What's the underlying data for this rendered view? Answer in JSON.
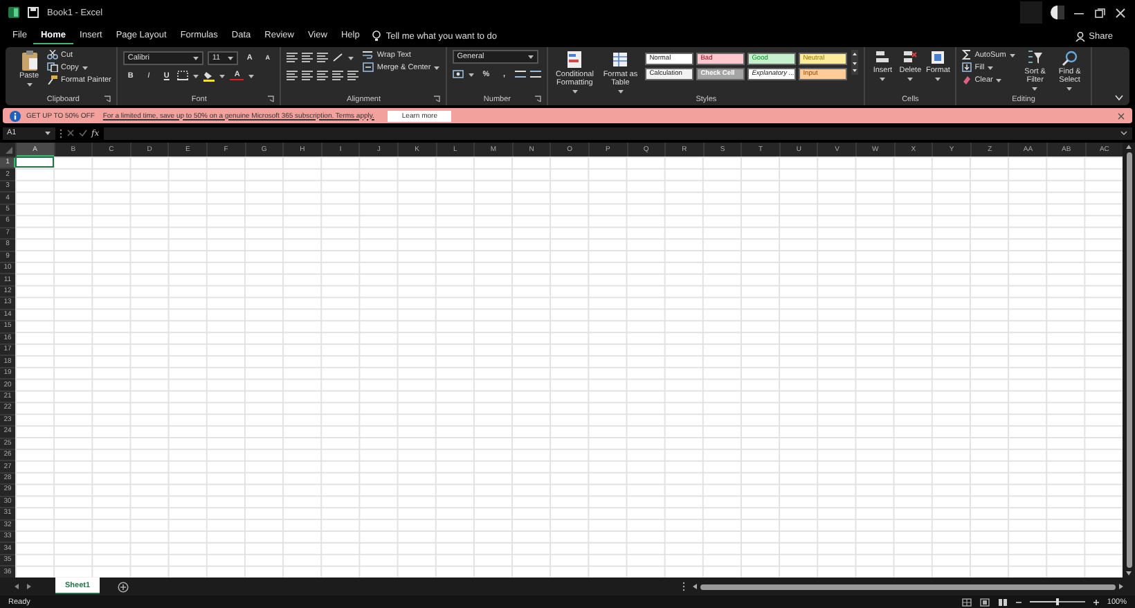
{
  "window": {
    "title": "Book1 - Excel"
  },
  "tabs": [
    {
      "label": "File",
      "selected": false
    },
    {
      "label": "Home",
      "selected": true
    },
    {
      "label": "Insert",
      "selected": false
    },
    {
      "label": "Page Layout",
      "selected": false
    },
    {
      "label": "Formulas",
      "selected": false
    },
    {
      "label": "Data",
      "selected": false
    },
    {
      "label": "Review",
      "selected": false
    },
    {
      "label": "View",
      "selected": false
    },
    {
      "label": "Help",
      "selected": false
    }
  ],
  "tell_me": {
    "placeholder": "Tell me what you want to do"
  },
  "share": "Share",
  "ribbon": {
    "groups": [
      {
        "kind": "clipboard",
        "name": "Clipboard",
        "paste": "Paste",
        "small": [
          "Cut",
          "Copy",
          "Format Painter"
        ]
      },
      {
        "kind": "font",
        "name": "Font",
        "font_name": "Calibri",
        "font_size": "11",
        "grow": "A",
        "shrink": "A",
        "format_buttons": [
          "B",
          "I",
          "U"
        ],
        "font_color": "A"
      },
      {
        "kind": "alignment",
        "name": "Alignment",
        "wrap": "Wrap Text",
        "merge": "Merge & Center"
      },
      {
        "kind": "number",
        "name": "Number",
        "format": "General",
        "percent": "%",
        "comma": ","
      },
      {
        "kind": "styles",
        "name": "Styles",
        "large": [
          "Conditional Formatting",
          "Format as Table"
        ],
        "cell_styles": [
          {
            "label": "Normal",
            "color": "#ffffff"
          },
          {
            "label": "Bad",
            "color": "#ffc7ce"
          },
          {
            "label": "Good",
            "color": "#c6efce"
          },
          {
            "label": "Neutral",
            "color": "#ffeb9c"
          },
          {
            "label": "Calculation",
            "color": "#f2f2f2"
          },
          {
            "label": "Check Cell",
            "color": "#a5a5a5"
          },
          {
            "label": "Explanatory ...",
            "color": "#ffffff"
          },
          {
            "label": "Input",
            "color": "#ffcc99"
          }
        ]
      },
      {
        "kind": "cells",
        "name": "Cells",
        "large": [
          "Insert",
          "Delete",
          "Format"
        ]
      },
      {
        "kind": "editing",
        "name": "Editing",
        "small": [
          "AutoSum",
          "Fill",
          "Clear"
        ],
        "large": [
          "Sort & Filter",
          "Find & Select"
        ]
      }
    ]
  },
  "infobar": {
    "headline": "GET UP TO 50% OFF",
    "link": "For a limited time, save up to 50% on a genuine Microsoft 365 subscription. Terms apply.",
    "button": "Learn more"
  },
  "formula_bar": {
    "name_box": "A1",
    "fx": "fx"
  },
  "columns": [
    {
      "label": "A",
      "selected": true
    },
    {
      "label": "B",
      "selected": false
    },
    {
      "label": "C",
      "selected": false
    },
    {
      "label": "D",
      "selected": false
    },
    {
      "label": "E",
      "selected": false
    },
    {
      "label": "F",
      "selected": false
    },
    {
      "label": "G",
      "selected": false
    },
    {
      "label": "H",
      "selected": false
    },
    {
      "label": "I",
      "selected": false
    },
    {
      "label": "J",
      "selected": false
    },
    {
      "label": "K",
      "selected": false
    },
    {
      "label": "L",
      "selected": false
    },
    {
      "label": "M",
      "selected": false
    },
    {
      "label": "N",
      "selected": false
    },
    {
      "label": "O",
      "selected": false
    },
    {
      "label": "P",
      "selected": false
    },
    {
      "label": "Q",
      "selected": false
    },
    {
      "label": "R",
      "selected": false
    },
    {
      "label": "S",
      "selected": false
    },
    {
      "label": "T",
      "selected": false
    },
    {
      "label": "U",
      "selected": false
    },
    {
      "label": "V",
      "selected": false
    },
    {
      "label": "W",
      "selected": false
    },
    {
      "label": "X",
      "selected": false
    },
    {
      "label": "Y",
      "selected": false
    },
    {
      "label": "Z",
      "selected": false
    },
    {
      "label": "AA",
      "selected": false
    },
    {
      "label": "AB",
      "selected": false
    },
    {
      "label": "AC",
      "selected": false
    }
  ],
  "rows": [
    {
      "label": "1",
      "selected": true
    },
    {
      "label": "2",
      "selected": false
    },
    {
      "label": "3",
      "selected": false
    },
    {
      "label": "4",
      "selected": false
    },
    {
      "label": "5",
      "selected": false
    },
    {
      "label": "6",
      "selected": false
    },
    {
      "label": "7",
      "selected": false
    },
    {
      "label": "8",
      "selected": false
    },
    {
      "label": "9",
      "selected": false
    },
    {
      "label": "10",
      "selected": false
    },
    {
      "label": "11",
      "selected": false
    },
    {
      "label": "12",
      "selected": false
    },
    {
      "label": "13",
      "selected": false
    },
    {
      "label": "14",
      "selected": false
    },
    {
      "label": "15",
      "selected": false
    },
    {
      "label": "16",
      "selected": false
    },
    {
      "label": "17",
      "selected": false
    },
    {
      "label": "18",
      "selected": false
    },
    {
      "label": "19",
      "selected": false
    },
    {
      "label": "20",
      "selected": false
    },
    {
      "label": "21",
      "selected": false
    },
    {
      "label": "22",
      "selected": false
    },
    {
      "label": "23",
      "selected": false
    },
    {
      "label": "24",
      "selected": false
    },
    {
      "label": "25",
      "selected": false
    },
    {
      "label": "26",
      "selected": false
    },
    {
      "label": "27",
      "selected": false
    },
    {
      "label": "28",
      "selected": false
    },
    {
      "label": "29",
      "selected": false
    },
    {
      "label": "30",
      "selected": false
    },
    {
      "label": "31",
      "selected": false
    },
    {
      "label": "32",
      "selected": false
    },
    {
      "label": "33",
      "selected": false
    },
    {
      "label": "34",
      "selected": false
    },
    {
      "label": "35",
      "selected": false
    },
    {
      "label": "36",
      "selected": false
    }
  ],
  "sheets": [
    {
      "label": "Sheet1",
      "selected": true
    }
  ],
  "status_bar": {
    "status": "Ready",
    "zoom": "100%",
    "zoom_slider": {
      "level": 0.5
    }
  }
}
